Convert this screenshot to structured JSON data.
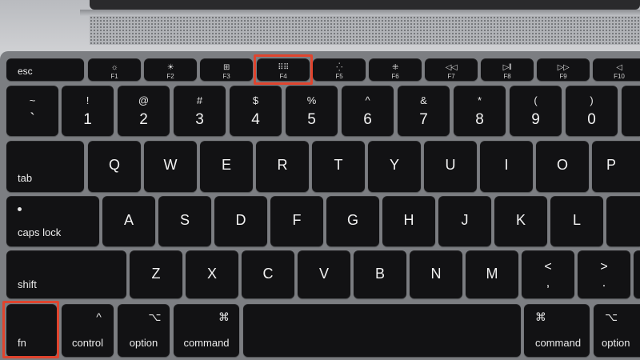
{
  "function_row": [
    {
      "id": "esc",
      "label": "esc"
    },
    {
      "id": "f1",
      "label": "F1",
      "icon": "☼"
    },
    {
      "id": "f2",
      "label": "F2",
      "icon": "☀"
    },
    {
      "id": "f3",
      "label": "F3",
      "icon": "⊞"
    },
    {
      "id": "f4",
      "label": "F4",
      "icon": "⠿⠿"
    },
    {
      "id": "f5",
      "label": "F5",
      "icon": "⁛"
    },
    {
      "id": "f6",
      "label": "F6",
      "icon": "⁜"
    },
    {
      "id": "f7",
      "label": "F7",
      "icon": "◁◁"
    },
    {
      "id": "f8",
      "label": "F8",
      "icon": "▷‖"
    },
    {
      "id": "f9",
      "label": "F9",
      "icon": "▷▷"
    },
    {
      "id": "f10",
      "label": "F10",
      "icon": "◁"
    }
  ],
  "number_row": [
    {
      "top": "~",
      "bottom": "`"
    },
    {
      "top": "!",
      "bottom": "1"
    },
    {
      "top": "@",
      "bottom": "2"
    },
    {
      "top": "#",
      "bottom": "3"
    },
    {
      "top": "$",
      "bottom": "4"
    },
    {
      "top": "%",
      "bottom": "5"
    },
    {
      "top": "^",
      "bottom": "6"
    },
    {
      "top": "&",
      "bottom": "7"
    },
    {
      "top": "*",
      "bottom": "8"
    },
    {
      "top": "(",
      "bottom": "9"
    },
    {
      "top": ")",
      "bottom": "0"
    }
  ],
  "qwerty_row": {
    "tab": "tab",
    "letters": [
      "Q",
      "W",
      "E",
      "R",
      "T",
      "Y",
      "U",
      "I",
      "O",
      "P"
    ]
  },
  "home_row": {
    "caps": "caps lock",
    "letters": [
      "A",
      "S",
      "D",
      "F",
      "G",
      "H",
      "J",
      "K",
      "L"
    ]
  },
  "shift_row": {
    "shift": "shift",
    "letters": [
      "Z",
      "X",
      "C",
      "V",
      "B",
      "N",
      "M"
    ],
    "comma": {
      "top": "<",
      "bottom": ","
    },
    "period": {
      "top": ">",
      "bottom": "."
    }
  },
  "bottom_row": {
    "fn": "fn",
    "control": {
      "label": "control",
      "symbol": "^"
    },
    "option_left": {
      "label": "option",
      "symbol": "⌥"
    },
    "command_left": {
      "label": "command",
      "symbol": "⌘"
    },
    "command_right": {
      "label": "command",
      "symbol": "⌘"
    },
    "option_right": {
      "label": "option",
      "symbol": "⌥"
    }
  },
  "highlight_color": "#e0442e",
  "highlighted_keys": [
    "F4",
    "fn"
  ]
}
